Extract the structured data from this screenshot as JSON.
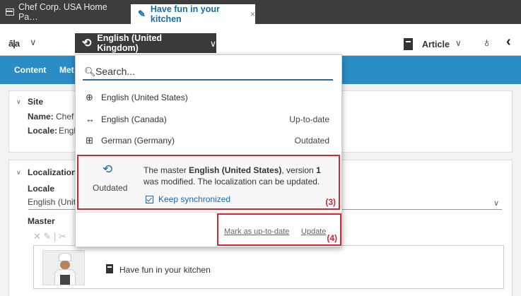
{
  "tabs": [
    {
      "label": "Chef Corp. USA Home Pa…"
    },
    {
      "label": "Have fun in your kitchen",
      "close": "×"
    }
  ],
  "toolbar": {
    "lang_icon": "ā|a",
    "locale_button": "English (United Kingdom)",
    "doctype_label": "Article",
    "chevron": "∨"
  },
  "nav": {
    "tabs": [
      "Content",
      "Met"
    ]
  },
  "site_panel": {
    "heading": "Site",
    "name_label": "Name:",
    "name_value": "Chef",
    "locale_label": "Locale:",
    "locale_value": "Engl"
  },
  "localization_panel": {
    "heading": "Localization",
    "locale_label": "Locale",
    "locale_value": "English (Unit",
    "master_label": "Master",
    "item_title": "Have fun in your kitchen"
  },
  "dropdown": {
    "search_placeholder": "Search...",
    "options": [
      {
        "label": "English (United States)",
        "status": "",
        "icon": "globe-icon"
      },
      {
        "label": "English (Canada)",
        "status": "Up-to-date",
        "icon": "arrows-icon"
      },
      {
        "label": "German (Germany)",
        "status": "Outdated",
        "icon": "translate-icon"
      }
    ],
    "detail": {
      "status": "Outdated",
      "msg_1": "The master ",
      "msg_locale": "English (United States)",
      "msg_2": ", version ",
      "msg_version": "1",
      "msg_3": " was modified. The localization can be updated.",
      "keep_sync": "Keep synchronized",
      "marker": "(3)"
    },
    "actions": {
      "mark": "Mark as up-to-date",
      "update": "Update",
      "marker": "(4)"
    }
  },
  "colors": {
    "accent": "#2a8dc6",
    "highlight": "#d9232f",
    "link": "#1a6aa8"
  }
}
